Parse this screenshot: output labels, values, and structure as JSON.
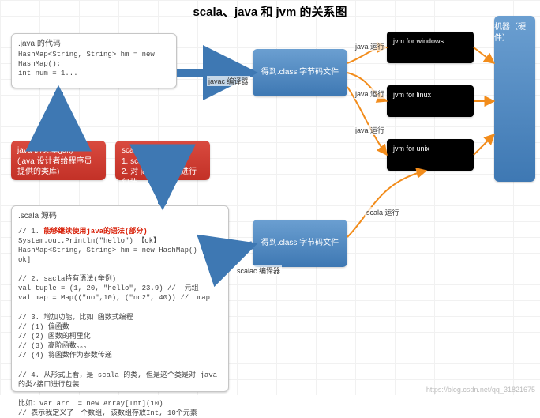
{
  "title": "scala、java 和 jvm 的关系图",
  "java_box": {
    "heading": ".java 的代码",
    "code": "HashMap<String, String> hm = new HashMap();\nint num = 1..."
  },
  "jdk_box": {
    "line1": "java 的类库(jdk)",
    "line2": "(java 设计者给程序员提供的类库)"
  },
  "sdk_box": {
    "line1": "scala 的类库(sdk)",
    "line2": "1. scala 特有类库",
    "line3": "2. 对 java 的类的进行包装"
  },
  "class1": "得到.class 字节码文件",
  "class2": "得到.class 字节码文件",
  "javac": "javac 编译器",
  "scalac": "scalac 编译器",
  "run_java1": "java 运行",
  "run_java2": "java 运行",
  "run_java3": "java 运行",
  "run_scala": "scala 运行",
  "jvm_win": "jvm for windows",
  "jvm_linux": "jvm for linux",
  "jvm_unix": "jvm for unix",
  "hardware": "机器（硬件）",
  "scala_box": {
    "heading": ".scala   源码",
    "c1a": "// 1. ",
    "c1b": "能够继续使用java的语法(部分)",
    "c2": "System.out.Println(\"hello\") 【ok】",
    "c3": "HashMap<String, String> hm = new HashMap() [不ok]",
    "c4": "// 2. sacla特有语法(举例)",
    "c5": "val tuple = (1, 20, \"hello\", 23.9) //  元组",
    "c6": "val map = Map((\"no\",10), (\"no2\", 40)) //  map",
    "c7": "// 3. 增加功能，比如 函数式编程",
    "c8": "// (1) 偏函数",
    "c9": "// (2) 函数的柯里化",
    "c10": "// (3) 高阶函数。。。",
    "c11": "// (4) 将函数作为参数传递",
    "c12": "// 4. 从形式上看，是 scala 的类, 但是这个类是对 java",
    "c13": "的类/接口进行包装",
    "c14": "比如：var arr  = new Array[Int](10)",
    "c15": "// 表示我定义了一个数组, 该数组存放Int, 10个元素"
  },
  "watermark": "https://blog.csdn.net/qq_31821675",
  "chart_data": {
    "type": "diagram",
    "nodes": [
      {
        "id": "java_src",
        "label": ".java 的代码"
      },
      {
        "id": "scala_src",
        "label": ".scala 源码"
      },
      {
        "id": "jdk",
        "label": "java 的类库(jdk)"
      },
      {
        "id": "sdk",
        "label": "scala 的类库(sdk)"
      },
      {
        "id": "class1",
        "label": "得到.class 字节码文件"
      },
      {
        "id": "class2",
        "label": "得到.class 字节码文件"
      },
      {
        "id": "jvm_win",
        "label": "jvm for windows"
      },
      {
        "id": "jvm_linux",
        "label": "jvm for linux"
      },
      {
        "id": "jvm_unix",
        "label": "jvm for unix"
      },
      {
        "id": "hw",
        "label": "机器（硬件）"
      }
    ],
    "edges": [
      {
        "from": "java_src",
        "to": "class1",
        "label": "javac 编译器"
      },
      {
        "from": "scala_src",
        "to": "class2",
        "label": "scalac 编译器"
      },
      {
        "from": "jdk",
        "to": "java_src",
        "label": ""
      },
      {
        "from": "sdk",
        "to": "scala_src",
        "label": ""
      },
      {
        "from": "class1",
        "to": "jvm_win",
        "label": "java 运行"
      },
      {
        "from": "class1",
        "to": "jvm_linux",
        "label": "java 运行"
      },
      {
        "from": "class1",
        "to": "jvm_unix",
        "label": "java 运行"
      },
      {
        "from": "class2",
        "to": "jvm_unix",
        "label": "scala 运行"
      },
      {
        "from": "jvm_win",
        "to": "hw",
        "label": ""
      },
      {
        "from": "jvm_linux",
        "to": "hw",
        "label": ""
      },
      {
        "from": "jvm_unix",
        "to": "hw",
        "label": ""
      }
    ]
  }
}
